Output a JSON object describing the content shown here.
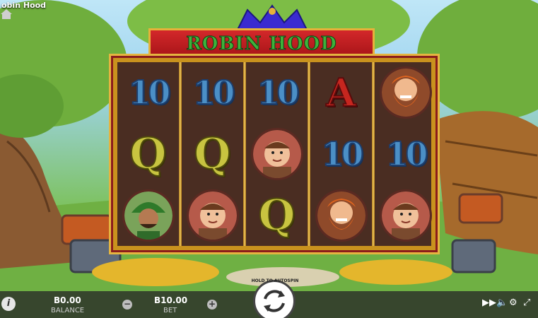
{
  "app": {
    "title": "obin Hood"
  },
  "game": {
    "title": "ROBIN HOOD"
  },
  "reels": [
    [
      "10",
      "Q",
      "robin"
    ],
    [
      "10",
      "Q",
      "friar"
    ],
    [
      "10",
      "friar",
      "Q"
    ],
    [
      "A",
      "10",
      "john"
    ],
    [
      "john",
      "10",
      "friar"
    ]
  ],
  "symbols": {
    "10": "10",
    "Q": "Q",
    "A": "A"
  },
  "footer": {
    "balance_value": "B0.00",
    "balance_label": "BALANCE",
    "bet_value": "B10.00",
    "bet_label": "BET",
    "minus": "−",
    "plus": "+",
    "info": "i",
    "spin_hint": "HOLD TO AUTOSPIN"
  },
  "icons": {
    "home": "home-icon",
    "info": "info-icon",
    "fast_forward": "fast-forward-icon",
    "sound": "sound-icon",
    "settings": "gear-icon",
    "fullscreen": "fullscreen-icon",
    "spin": "spin-arrows-icon"
  },
  "colors": {
    "frame_gold": "#c9921e",
    "banner_red": "#b81a1c",
    "ten_blue": "#4b8fc6",
    "queen_yellow": "#c8c440",
    "ace_red": "#c6261f"
  }
}
